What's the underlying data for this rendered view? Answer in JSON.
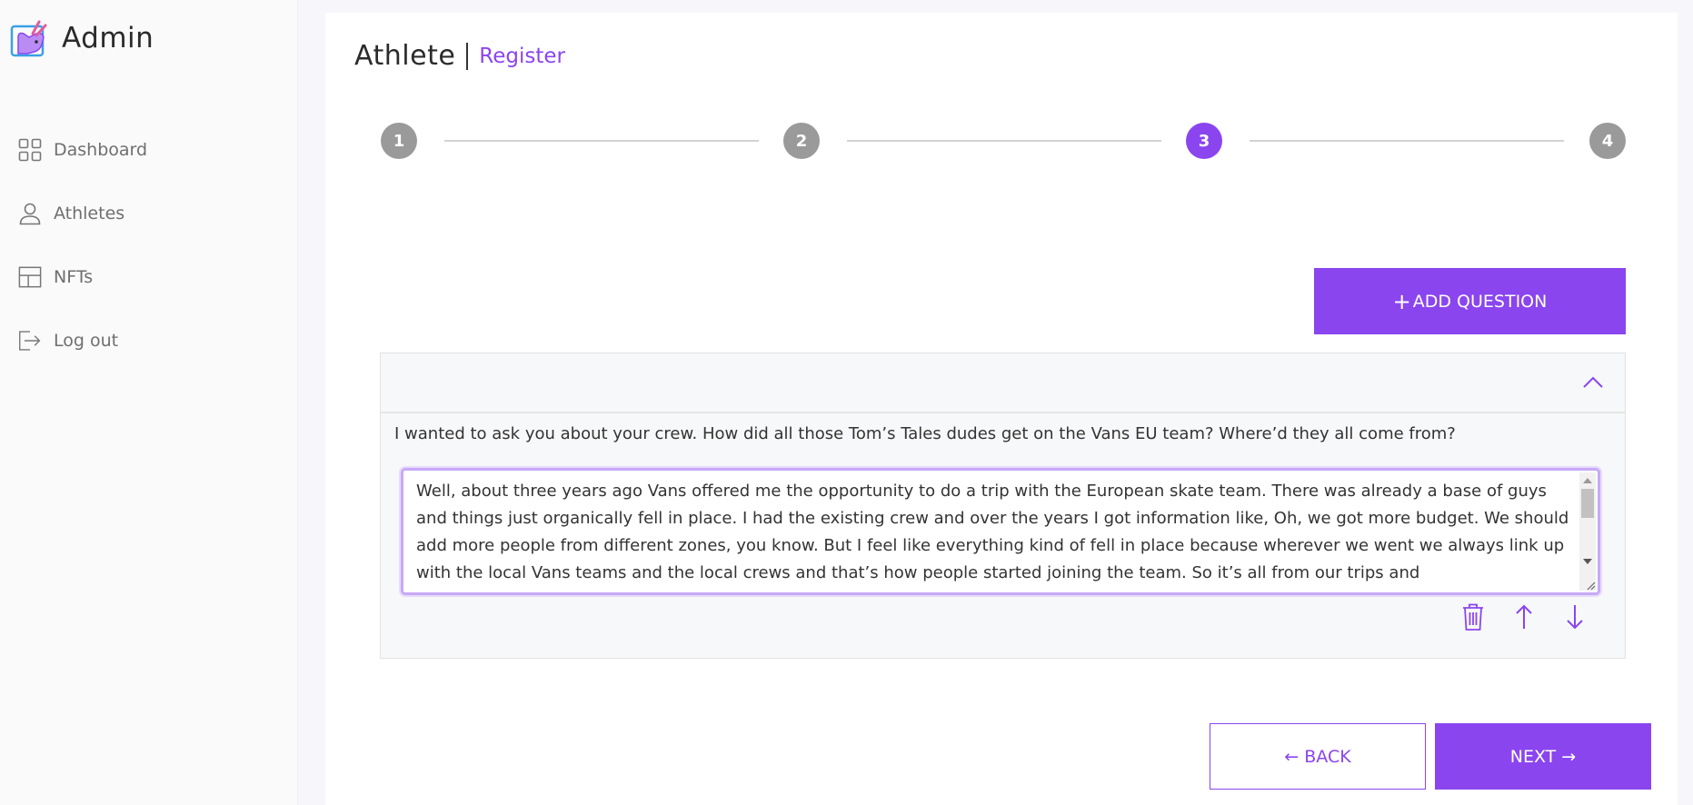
{
  "app": {
    "name": "Admin"
  },
  "sidebar": {
    "items": [
      {
        "label": "Dashboard",
        "icon": "grid-icon"
      },
      {
        "label": "Athletes",
        "icon": "user-icon"
      },
      {
        "label": "NFTs",
        "icon": "layout-icon"
      },
      {
        "label": "Log out",
        "icon": "logout-icon"
      }
    ]
  },
  "header": {
    "title": "Athlete",
    "subtitle": "Register"
  },
  "stepper": {
    "steps": [
      "1",
      "2",
      "3",
      "4"
    ],
    "active": "3"
  },
  "actions": {
    "add_question": "ADD QUESTION",
    "add_question_prefix": "+",
    "back": "← BACK",
    "next": "NEXT →"
  },
  "question_item": {
    "question": "I wanted to ask you about your crew. How did all those Tom’s Tales dudes get on the Vans EU team? Where’d they all come from?",
    "answer": " Well, about three years ago Vans offered me the opportunity to do a trip with the European skate team. There was already a base of guys and things just organically fell in place. I had the existing crew and over the years I got information like, Oh, we got more budget. We should add more people from different zones, you know. But I feel like everything kind of fell in place because wherever we went we always link up with the local Vans teams and the local crews and that’s how people started joining the team. So it’s all from our trips and"
  },
  "colors": {
    "accent": "#8a45ef",
    "step_inactive": "#9a9a9a",
    "sidebar_bg": "#fafafa"
  }
}
